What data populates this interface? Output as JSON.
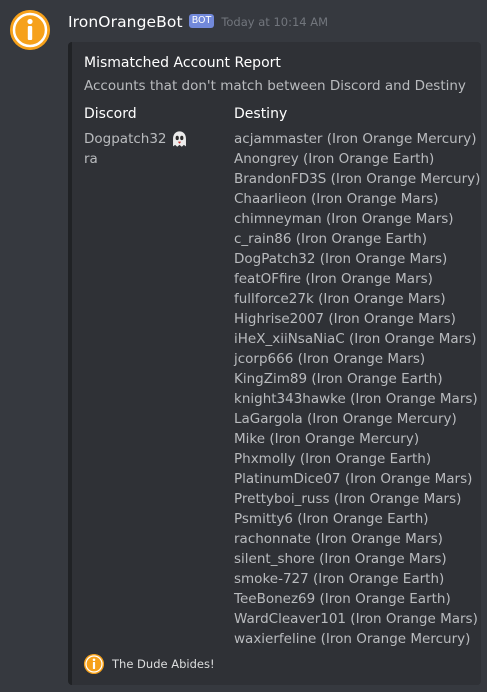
{
  "message": {
    "username": "IronOrangeBot",
    "bot_tag": "BOT",
    "timestamp": "Today at 10:14 AM",
    "avatar_icon": "iron-orange-logo-icon",
    "accent_color": "#f6a11b"
  },
  "embed": {
    "title": "Mismatched Account Report",
    "description": "Accounts that don't match between Discord and Destiny",
    "fields": {
      "discord": {
        "name": "Discord",
        "values": [
          {
            "text": "Dogpatch32",
            "emoji": "ghost-icon"
          },
          {
            "text": "ra"
          }
        ]
      },
      "destiny": {
        "name": "Destiny",
        "values": [
          "acjammaster (Iron Orange Mercury)",
          "Anongrey (Iron Orange Earth)",
          "BrandonFD3S (Iron Orange Mercury)",
          "Chaarlieon (Iron Orange Mars)",
          "chimneyman (Iron Orange Mars)",
          "c_rain86 (Iron Orange Earth)",
          "DogPatch32 (Iron Orange Mars)",
          "featOFfire (Iron Orange Mars)",
          "fullforce27k (Iron Orange Mars)",
          "Highrise2007 (Iron Orange Mars)",
          "iHeX_xiiNsaNiaC (Iron Orange Mars)",
          "jcorp666 (Iron Orange Mars)",
          "KingZim89 (Iron Orange Earth)",
          "knight343hawke (Iron Orange Mars)",
          "LaGargola (Iron Orange Mercury)",
          "Mike (Iron Orange Mercury)",
          "Phxmolly (Iron Orange Earth)",
          "PlatinumDice07 (Iron Orange Mars)",
          "Prettyboi_russ (Iron Orange Mars)",
          "Psmitty6 (Iron Orange Earth)",
          "rachonnate (Iron Orange Mars)",
          "silent_shore (Iron Orange Mars)",
          "smoke-727 (Iron Orange Earth)",
          "TeeBonez69 (Iron Orange Earth)",
          "WardCleaver101 (Iron Orange Mars)",
          "waxierfeline (Iron Orange Mercury)"
        ]
      }
    },
    "footer": {
      "text": "The Dude Abides!",
      "icon": "iron-orange-logo-icon"
    }
  }
}
